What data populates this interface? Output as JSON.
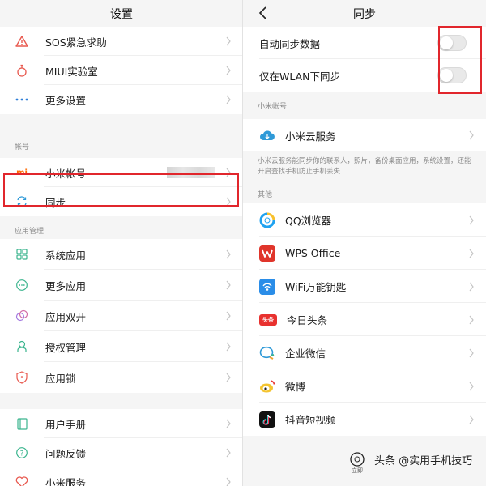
{
  "left": {
    "title": "设置",
    "group1": [
      {
        "label": "SOS紧急求助",
        "icon": "warning-triangle-icon"
      },
      {
        "label": "MIUI实验室",
        "icon": "flask-icon"
      },
      {
        "label": "更多设置",
        "icon": "more-dots-icon"
      }
    ],
    "section_account": "帐号",
    "account_rows": [
      {
        "label": "小米帐号",
        "icon": "mi-logo-icon",
        "icon_text": "mi"
      },
      {
        "label": "同步",
        "icon": "sync-icon"
      }
    ],
    "section_apps": "应用管理",
    "app_rows": [
      {
        "label": "系统应用",
        "icon": "grid-apps-icon"
      },
      {
        "label": "更多应用",
        "icon": "more-apps-icon"
      },
      {
        "label": "应用双开",
        "icon": "dual-apps-icon"
      },
      {
        "label": "授权管理",
        "icon": "permission-icon"
      },
      {
        "label": "应用锁",
        "icon": "app-lock-icon"
      }
    ],
    "help_rows": [
      {
        "label": "用户手册",
        "icon": "manual-icon"
      },
      {
        "label": "问题反馈",
        "icon": "feedback-icon"
      },
      {
        "label": "小米服务",
        "icon": "heart-icon"
      }
    ]
  },
  "right": {
    "title": "同步",
    "toggles": [
      {
        "label": "自动同步数据",
        "on": false
      },
      {
        "label": "仅在WLAN下同步",
        "on": false
      }
    ],
    "section_account": "小米帐号",
    "cloud_label": "小米云服务",
    "cloud_desc": "小米云服务能同步你的联系人，照片，备份桌面应用，系统设置，还能开启查找手机防止手机丢失",
    "section_other": "其他",
    "apps": [
      {
        "label": "QQ浏览器",
        "icon": "qq-browser-icon"
      },
      {
        "label": "WPS Office",
        "icon": "wps-office-icon"
      },
      {
        "label": "WiFi万能钥匙",
        "icon": "wifi-key-icon"
      },
      {
        "label": "今日头条",
        "icon": "toutiao-icon",
        "icon_text": "头条"
      },
      {
        "label": "企业微信",
        "icon": "wecom-icon"
      },
      {
        "label": "微博",
        "icon": "weibo-icon"
      },
      {
        "label": "抖音短视频",
        "icon": "douyin-icon"
      }
    ]
  },
  "watermark": {
    "text": "头条 @实用手机技巧",
    "small": "立即"
  },
  "colors": {
    "highlight": "#e1262c",
    "mi_orange": "#ff6900",
    "toutiao_red": "#e8312f",
    "wps_red": "#e0352b"
  }
}
